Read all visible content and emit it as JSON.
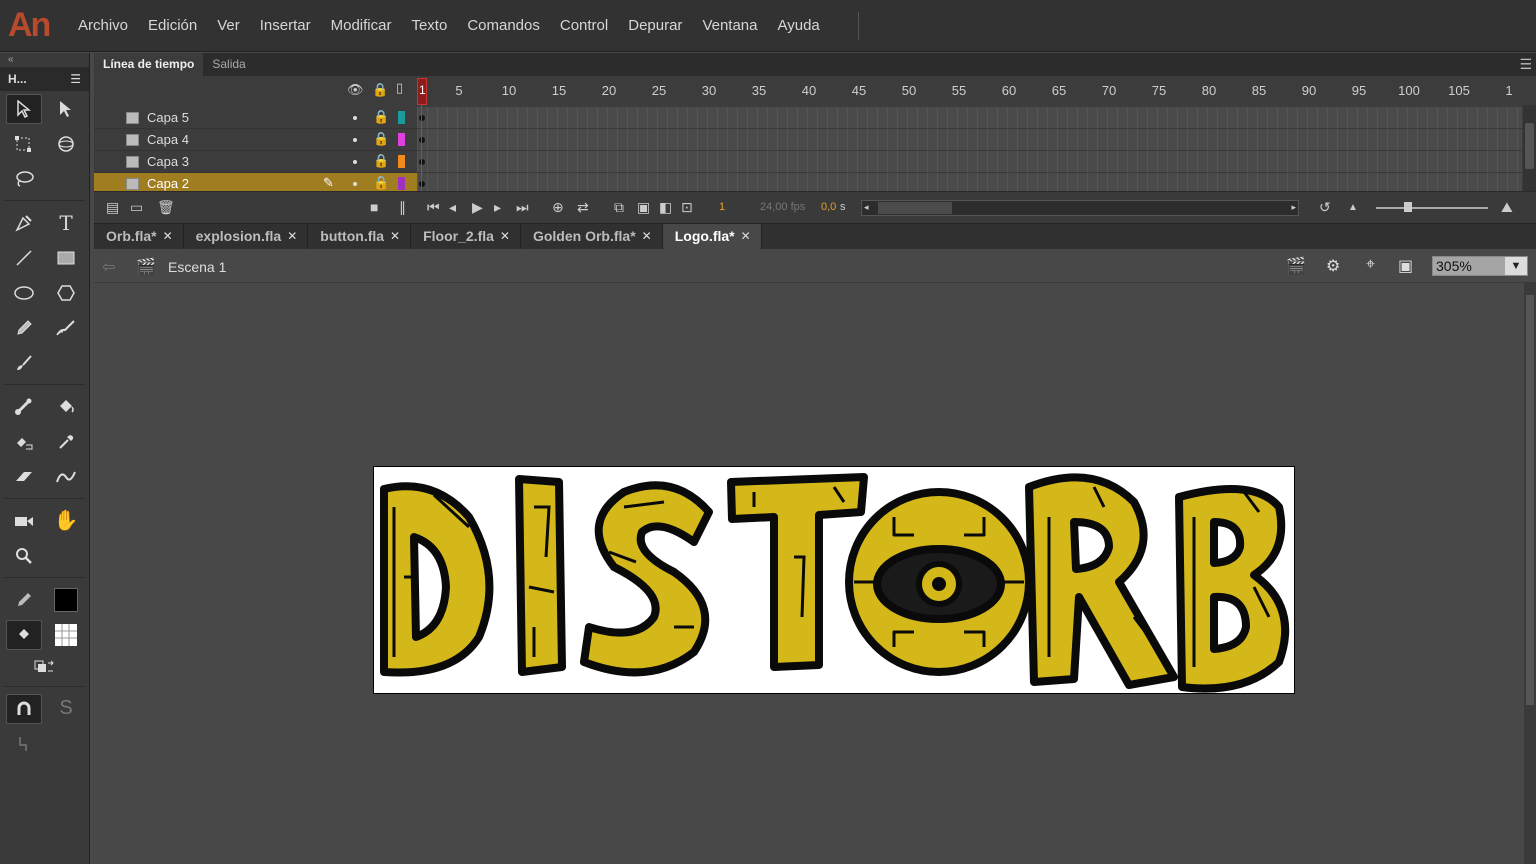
{
  "app": {
    "logo": "An"
  },
  "menu": [
    "Archivo",
    "Edición",
    "Ver",
    "Insertar",
    "Modificar",
    "Texto",
    "Comandos",
    "Control",
    "Depurar",
    "Ventana",
    "Ayuda"
  ],
  "tools_panel": {
    "collapse": "«",
    "title": "H..."
  },
  "timeline": {
    "tabs": [
      "Línea de tiempo",
      "Salida"
    ],
    "ruler": [
      "1",
      "5",
      "10",
      "15",
      "20",
      "25",
      "30",
      "35",
      "40",
      "45",
      "50",
      "55",
      "60",
      "65",
      "70",
      "75",
      "80",
      "85",
      "90",
      "95",
      "100",
      "105",
      "1"
    ],
    "playhead": "1",
    "layers": [
      {
        "name": "Capa 5",
        "color": "#1a9a9a",
        "selected": false
      },
      {
        "name": "Capa 4",
        "color": "#e040e0",
        "selected": false
      },
      {
        "name": "Capa 3",
        "color": "#f08a1a",
        "selected": false
      },
      {
        "name": "Capa 2",
        "color": "#a030c0",
        "selected": true
      }
    ],
    "current_frame": "1",
    "fps": "24,00 fps",
    "seconds": "0,0",
    "seconds_unit": "s"
  },
  "documents": [
    {
      "name": "Orb.fla*",
      "active": false
    },
    {
      "name": "explosion.fla",
      "active": false
    },
    {
      "name": "button.fla",
      "active": false
    },
    {
      "name": "Floor_2.fla",
      "active": false
    },
    {
      "name": "Golden Orb.fla*",
      "active": false
    },
    {
      "name": "Logo.fla*",
      "active": true
    }
  ],
  "edit_bar": {
    "scene": "Escena 1",
    "zoom": "305%"
  },
  "stage": {
    "background": "#ffffff",
    "logo_fill": "#d4b81a",
    "logo_text": "DISTORB"
  }
}
